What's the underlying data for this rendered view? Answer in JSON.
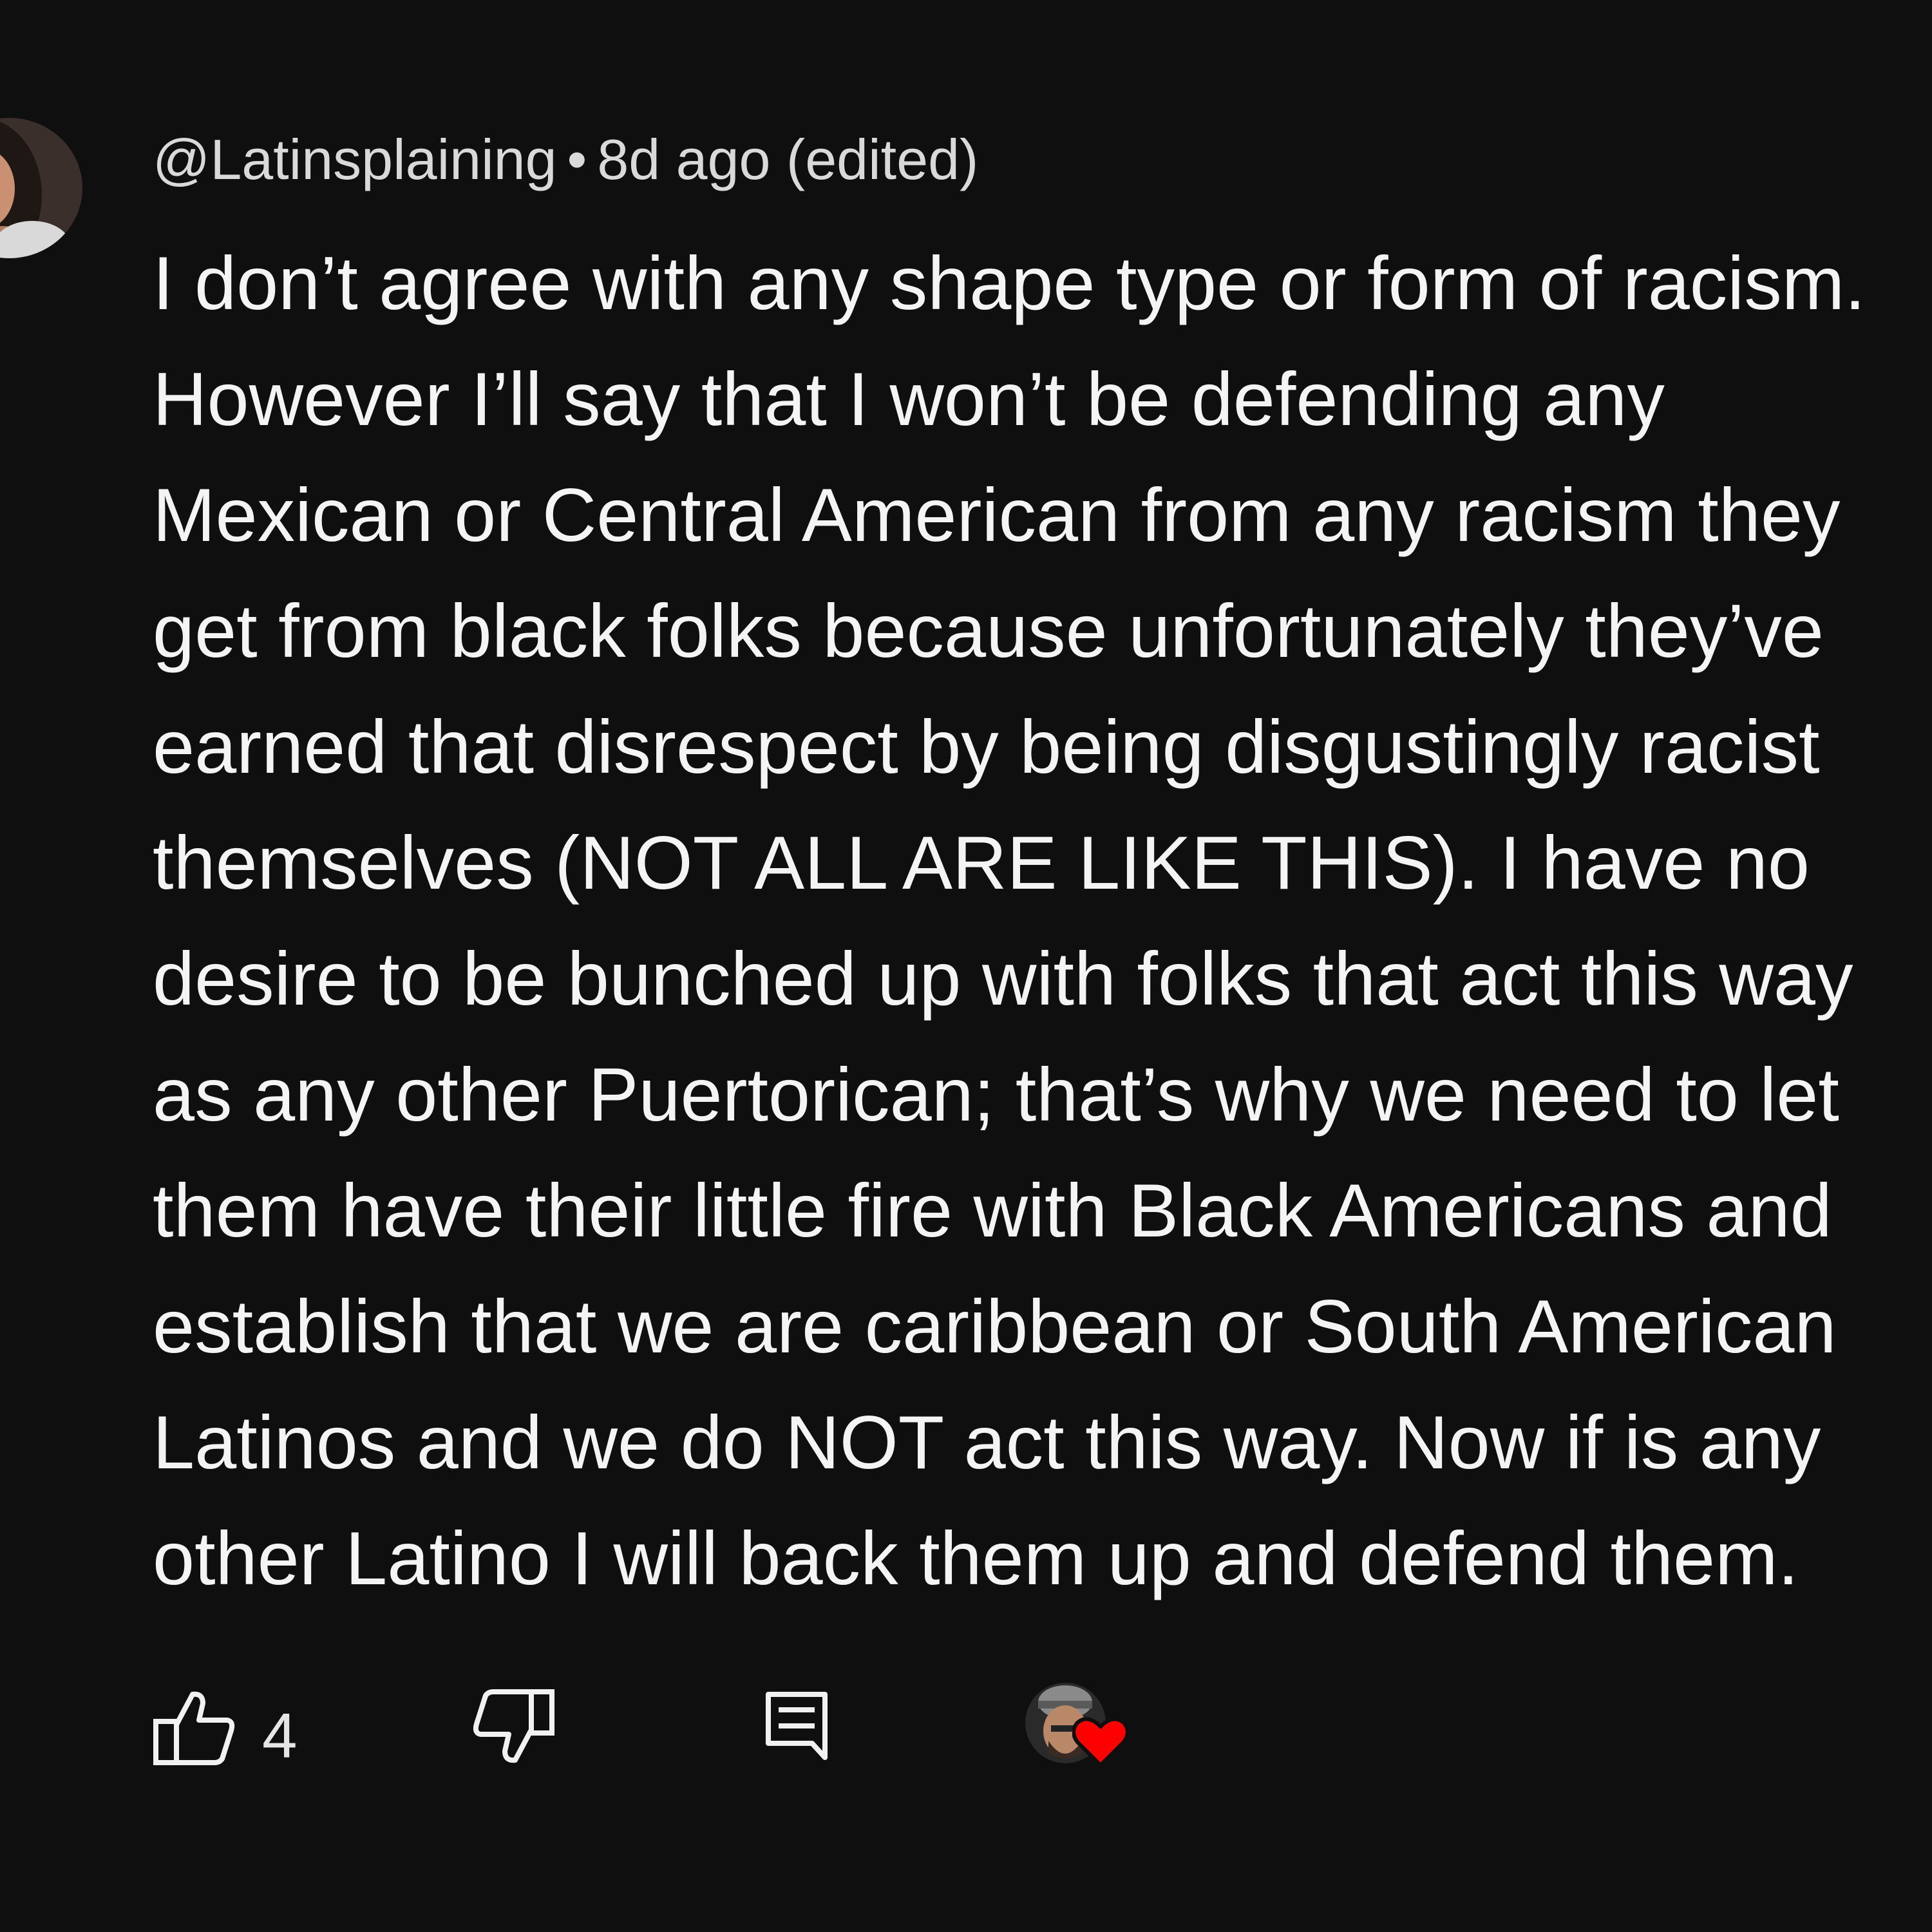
{
  "comment": {
    "author": "@Latinsplaining",
    "separator": "•",
    "timestamp": "8d ago (edited)",
    "lines": [
      "I don’t agree with any shape type or form of racism.",
      "However I’ll say that I won’t be defending any",
      "Mexican or Central American from any racism they",
      "get from black folks because unfortunately they’ve",
      "earned that disrespect by being disgustingly racist",
      "themselves (NOT ALL ARE LIKE THIS). I have no",
      "desire to be bunched up with folks that act this way",
      "as any other Puertorican; that’s why we need to let",
      "them have their little fire with Black Americans and",
      "establish that we are caribbean or South American",
      "Latinos and we do NOT act this way. Now if is any",
      "other Latino I will back them up and defend them."
    ]
  },
  "actions": {
    "like_count": "4",
    "like_icon": "thumbs-up-icon",
    "dislike_icon": "thumbs-down-icon",
    "reply_icon": "reply-comment-icon",
    "creator_heart_icon": "heart-icon"
  },
  "colors": {
    "background": "#0f0f0f",
    "text": "#f1f1f1",
    "meta_text": "#d9d9d9",
    "heart": "#ff0000"
  }
}
